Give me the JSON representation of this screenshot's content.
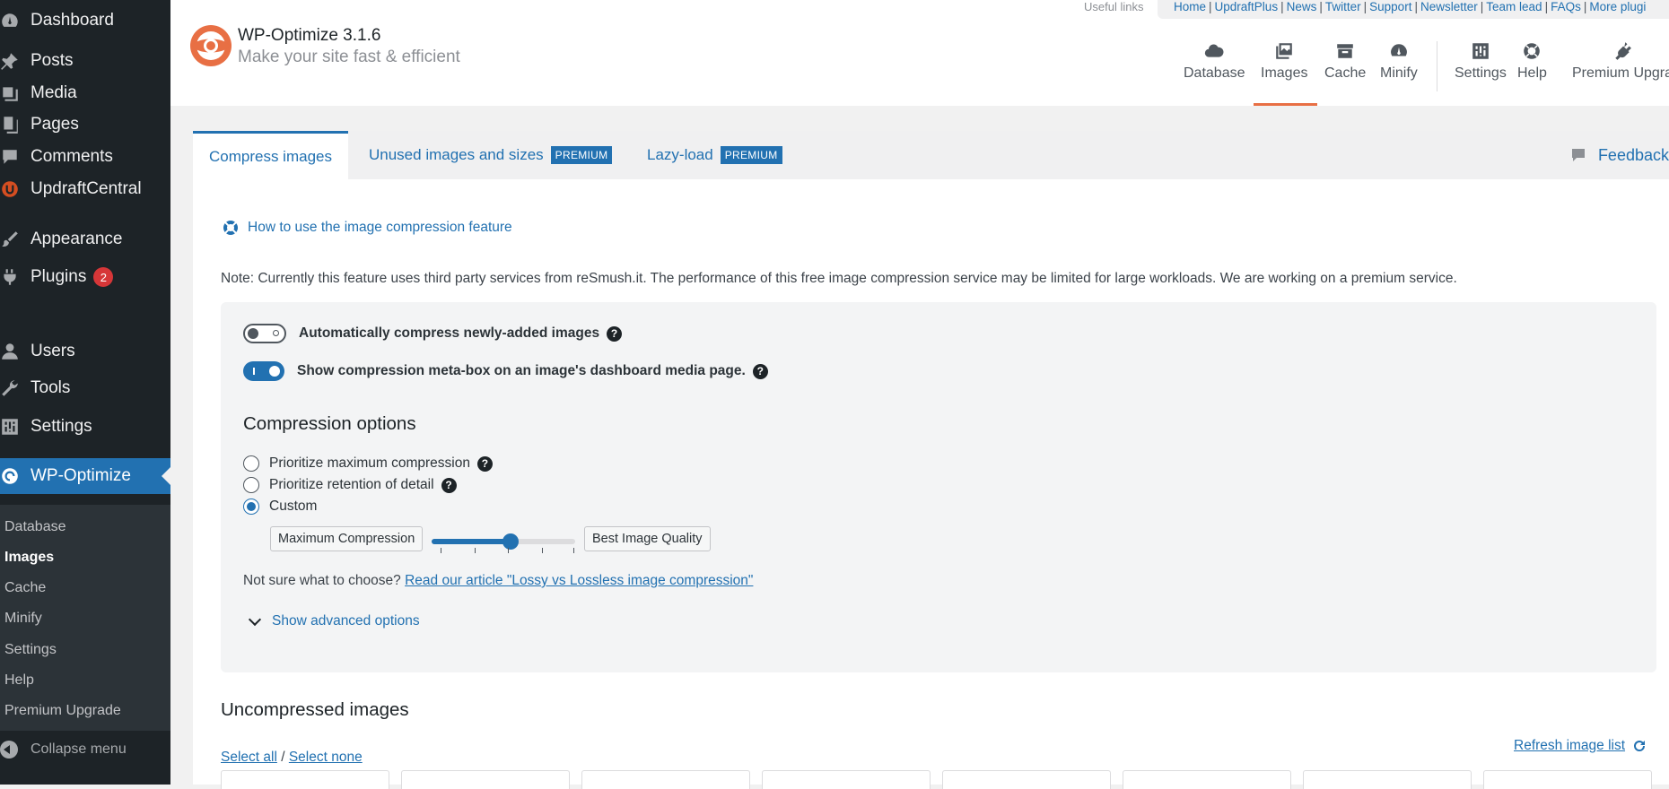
{
  "sidebar": {
    "items": [
      {
        "label": "Dashboard",
        "icon": "dashboard-icon"
      },
      {
        "label": "Posts",
        "icon": "pin-icon"
      },
      {
        "label": "Media",
        "icon": "media-icon"
      },
      {
        "label": "Pages",
        "icon": "pages-icon"
      },
      {
        "label": "Comments",
        "icon": "comment-icon"
      },
      {
        "label": "UpdraftCentral",
        "icon": "updraft-icon"
      },
      {
        "label": "Appearance",
        "icon": "brush-icon"
      },
      {
        "label": "Plugins",
        "icon": "plugin-icon",
        "badge": "2"
      },
      {
        "label": "Users",
        "icon": "user-icon"
      },
      {
        "label": "Tools",
        "icon": "wrench-icon"
      },
      {
        "label": "Settings",
        "icon": "settings-icon"
      },
      {
        "label": "WP-Optimize",
        "icon": "wpo-icon"
      }
    ],
    "submenu": [
      "Database",
      "Images",
      "Cache",
      "Minify",
      "Settings",
      "Help",
      "Premium Upgrade"
    ],
    "current_submenu": "Images",
    "collapse_label": "Collapse menu"
  },
  "header": {
    "title": "WP-Optimize 3.1.6",
    "subtitle": "Make your site fast & efficient",
    "useful_links_label": "Useful links",
    "links": [
      "Home",
      "UpdraftPlus",
      "News",
      "Twitter",
      "Support",
      "Newsletter",
      "Team lead",
      "FAQs",
      "More plugi"
    ],
    "nav": [
      {
        "label": "Database",
        "icon": "cloud-icon"
      },
      {
        "label": "Images",
        "icon": "images-icon"
      },
      {
        "label": "Cache",
        "icon": "archive-icon"
      },
      {
        "label": "Minify",
        "icon": "gauge-icon"
      },
      {
        "label": "Settings",
        "icon": "sliders-icon"
      },
      {
        "label": "Help",
        "icon": "lifebuoy-icon"
      },
      {
        "label": "Premium Upgra",
        "icon": "plug-icon"
      }
    ],
    "active_nav": "Images"
  },
  "tabs": {
    "items": [
      {
        "label": "Compress images",
        "premium": ""
      },
      {
        "label": "Unused images and sizes",
        "premium": "PREMIUM"
      },
      {
        "label": "Lazy-load",
        "premium": "PREMIUM"
      }
    ],
    "feedback": "Feedback"
  },
  "content": {
    "howto": "How to use the image compression feature",
    "note": "Note: Currently this feature uses third party services from reSmush.it. The performance of this free image compression service may be limited for large workloads. We are working on a premium service.",
    "toggle_auto": {
      "label": "Automatically compress newly-added images",
      "on": false
    },
    "toggle_metabox": {
      "label": "Show compression meta-box on an image's dashboard media page.",
      "on": true
    },
    "compression_heading": "Compression options",
    "radio_options": [
      "Prioritize maximum compression",
      "Prioritize retention of detail",
      "Custom"
    ],
    "selected_option": "Custom",
    "slider": {
      "left_label": "Maximum Compression",
      "right_label": "Best Image Quality",
      "value": 0.55
    },
    "not_sure_text": "Not sure what to choose?",
    "article_link": "Read our article \"Lossy vs Lossless image compression\"",
    "advanced_link": "Show advanced options",
    "uncompressed_title": "Uncompressed images",
    "select_all": "Select all",
    "slash": "/",
    "select_none": "Select none",
    "refresh": "Refresh image list"
  },
  "colors": {
    "accent": "#2271b1",
    "sidebar_bg": "#1d2327",
    "brand_orange": "#e86f44",
    "badge_red": "#d63638"
  }
}
